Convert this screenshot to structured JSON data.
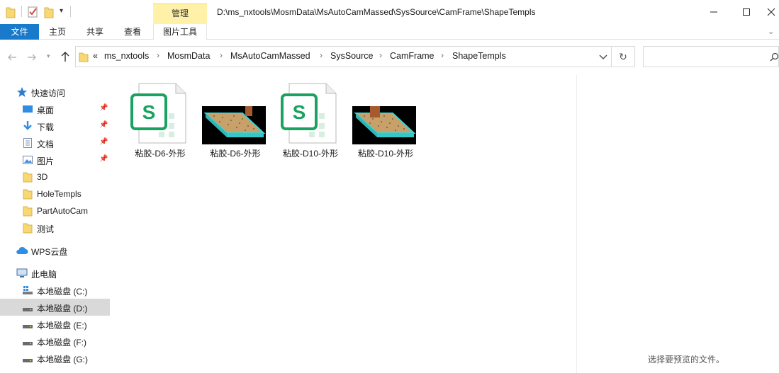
{
  "titlebar": {
    "path": "D:\\ms_nxtools\\MosmData\\MsAutoCamMassed\\SysSource\\CamFrame\\ShapeTempls",
    "context_tab": "管理"
  },
  "ribbon": {
    "tabs": [
      "文件",
      "主页",
      "共享",
      "查看",
      "图片工具"
    ]
  },
  "address": {
    "overflow": "«",
    "crumbs": [
      "ms_nxtools",
      "MosmData",
      "MsAutoCamMassed",
      "SysSource",
      "CamFrame",
      "ShapeTempls"
    ]
  },
  "sidebar": {
    "quick_access": "快速访问",
    "pinned": [
      "桌面",
      "下载",
      "文档",
      "图片"
    ],
    "folders": [
      "3D",
      "HoleTempls",
      "PartAutoCam",
      "测试"
    ],
    "wps": "WPS云盘",
    "this_pc": "此电脑",
    "drives": [
      "本地磁盘 (C:)",
      "本地磁盘 (D:)",
      "本地磁盘 (E:)",
      "本地磁盘 (F:)",
      "本地磁盘 (G:)"
    ],
    "selected_drive": "本地磁盘 (D:)"
  },
  "files": [
    {
      "name": "粘胶-D6-外形",
      "icon": "wps-spreadsheet-icon"
    },
    {
      "name": "粘胶-D6-外形",
      "icon": "image-thumbnail"
    },
    {
      "name": "粘胶-D10-外形",
      "icon": "wps-spreadsheet-icon"
    },
    {
      "name": "粘胶-D10-外形",
      "icon": "image-thumbnail"
    }
  ],
  "preview": {
    "message": "选择要预览的文件。"
  },
  "colors": {
    "file_tab": "#1979ca",
    "manage_tab": "#fff2a8",
    "selected_row": "#d9d9d9",
    "wps_green": "#1aa262"
  }
}
